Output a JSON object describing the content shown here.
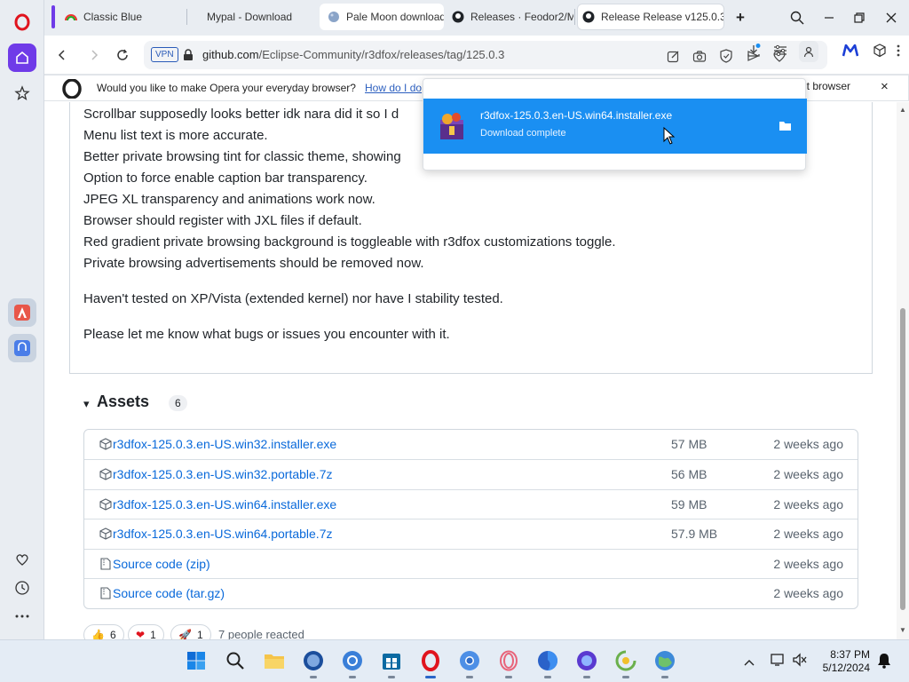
{
  "browser": {
    "tabs": [
      {
        "title": "Classic Blue"
      },
      {
        "title": "Mypal - Download"
      },
      {
        "title": "Pale Moon download"
      },
      {
        "title": "Releases · Feodor2/M"
      },
      {
        "title": "Release Release v125.0.3"
      }
    ],
    "new_tab_label": "+",
    "vpn_badge": "VPN",
    "url_host": "github.com",
    "url_path": "/Eclipse-Community/r3dfox/releases/tag/125.0.3"
  },
  "infobar": {
    "message": "Would you like to make Opera your everyday browser?",
    "link": "How do I do",
    "button_partial": "lt browser",
    "close": "×"
  },
  "download_popup": {
    "filename": "r3dfox-125.0.3.en-US.win64.installer.exe",
    "status": "Download complete"
  },
  "release_notes": {
    "lines": [
      "Scrollbar supposedly looks better idk nara did it so I d",
      "Menu list text is more accurate.",
      "Better private browsing tint for classic theme, showing",
      "Option to force enable caption bar transparency.",
      "JPEG XL transparency and animations work now.",
      "Browser should register with JXL files if default.",
      "Red gradient private browsing background is toggleable with r3dfox customizations toggle.",
      "Private browsing advertisements should be removed now."
    ],
    "paragraph1": "Haven't tested on XP/Vista (extended kernel) nor have I stability tested.",
    "paragraph2": "Please let me know what bugs or issues you encounter with it."
  },
  "assets": {
    "heading": "Assets",
    "count": "6",
    "toggle_glyph": "▾",
    "rows": [
      {
        "name": "r3dfox-125.0.3.en-US.win32.installer.exe",
        "size": "57 MB",
        "date": "2 weeks ago",
        "icon": "package-icon"
      },
      {
        "name": "r3dfox-125.0.3.en-US.win32.portable.7z",
        "size": "56 MB",
        "date": "2 weeks ago",
        "icon": "package-icon"
      },
      {
        "name": "r3dfox-125.0.3.en-US.win64.installer.exe",
        "size": "59 MB",
        "date": "2 weeks ago",
        "icon": "package-icon"
      },
      {
        "name": "r3dfox-125.0.3.en-US.win64.portable.7z",
        "size": "57.9 MB",
        "date": "2 weeks ago",
        "icon": "package-icon"
      },
      {
        "name": "Source code",
        "suffix": "(zip)",
        "size": "",
        "date": "2 weeks ago",
        "icon": "file-zip-icon"
      },
      {
        "name": "Source code",
        "suffix": "(tar.gz)",
        "size": "",
        "date": "2 weeks ago",
        "icon": "file-zip-icon"
      }
    ]
  },
  "reactions": [
    {
      "emoji": "👍",
      "count": "6"
    },
    {
      "emoji": "❤",
      "count": "1"
    },
    {
      "emoji": "🚀",
      "count": "1"
    }
  ],
  "reactions_summary": "7 people reacted",
  "clock": {
    "time": "8:37 PM",
    "date": "5/12/2024"
  },
  "colors": {
    "accent": "#1a8ff2",
    "link": "#0969da",
    "opera_red": "#e0141e"
  }
}
